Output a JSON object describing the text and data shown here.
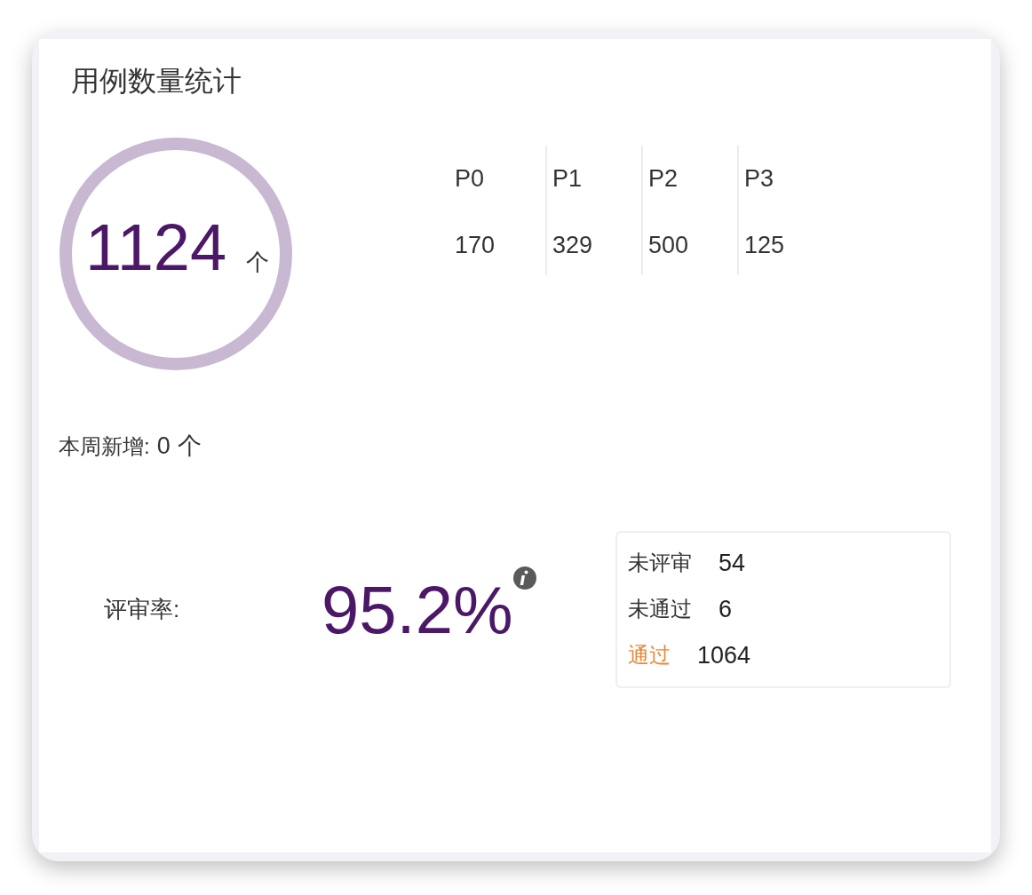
{
  "card": {
    "title": "用例数量统计"
  },
  "total": {
    "value": "1124",
    "unit": "个"
  },
  "priorities": [
    {
      "label": "P0",
      "count": "170"
    },
    {
      "label": "P1",
      "count": "329"
    },
    {
      "label": "P2",
      "count": "500"
    },
    {
      "label": "P3",
      "count": "125"
    }
  ],
  "weekly_new": {
    "label": "本周新增:",
    "value": "0",
    "unit": "个"
  },
  "review": {
    "label": "评审率:",
    "rate": "95.2%",
    "items": [
      {
        "label": "未评审",
        "value": "54",
        "color": "#333333"
      },
      {
        "label": "未通过",
        "value": "6",
        "color": "#333333"
      },
      {
        "label": "通过",
        "value": "1064",
        "color": "#e8883a"
      }
    ]
  }
}
